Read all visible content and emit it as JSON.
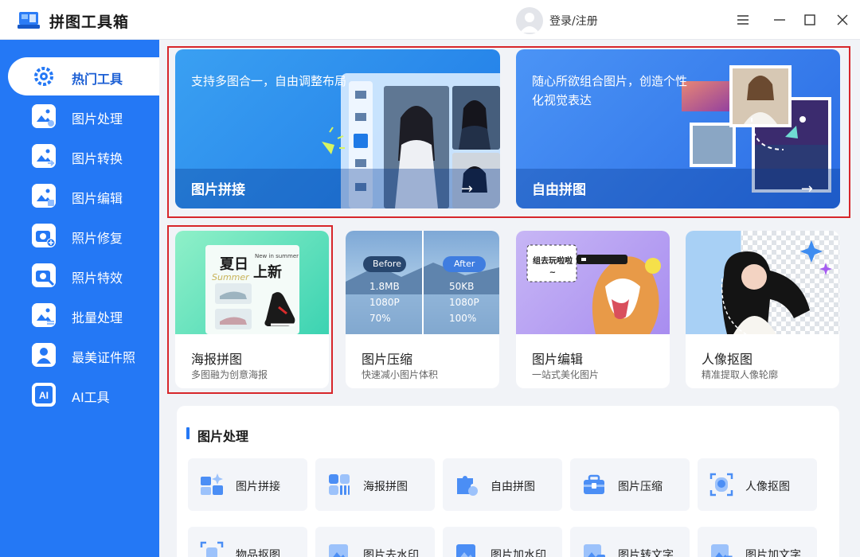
{
  "app": {
    "title": "拼图工具箱",
    "login_text": "登录/注册"
  },
  "colors": {
    "accent": "#2478f5",
    "highlight_border": "#d7262a"
  },
  "sidebar": {
    "items": [
      {
        "label": "热门工具",
        "icon": "gear-icon",
        "active": true
      },
      {
        "label": "图片处理",
        "icon": "image-process-icon"
      },
      {
        "label": "图片转换",
        "icon": "image-convert-icon"
      },
      {
        "label": "图片编辑",
        "icon": "image-edit-icon"
      },
      {
        "label": "照片修复",
        "icon": "camera-plus-icon"
      },
      {
        "label": "照片特效",
        "icon": "camera-effect-icon"
      },
      {
        "label": "批量处理",
        "icon": "batch-icon"
      },
      {
        "label": "最美证件照",
        "icon": "id-photo-icon"
      },
      {
        "label": "AI工具",
        "icon": "ai-icon"
      }
    ]
  },
  "banners": [
    {
      "desc": "支持多图合一，自由调整布局",
      "title": "图片拼接",
      "arrow": "→"
    },
    {
      "desc": "随心所欲组合图片，创造个性化视觉表达",
      "title": "自由拼图",
      "arrow": "→"
    }
  ],
  "cards": [
    {
      "title": "海报拼图",
      "sub": "多图融为创意海报",
      "img_text": {
        "main_a": "夏日",
        "main_b": "上新",
        "small": "New in summer",
        "script": "Summer"
      }
    },
    {
      "title": "图片压缩",
      "sub": "快速减小图片体积",
      "img_text": {
        "before": "Before",
        "after": "After",
        "before_vals": [
          "1.8MB",
          "1080P",
          "70%"
        ],
        "after_vals": [
          "50KB",
          "1080P",
          "100%"
        ]
      }
    },
    {
      "title": "图片编辑",
      "sub": "一站式美化图片",
      "img_text": {
        "bubble": "组去玩啦啦~"
      }
    },
    {
      "title": "人像抠图",
      "sub": "精准提取人像轮廓"
    }
  ],
  "section": {
    "title": "图片处理",
    "row1": [
      {
        "label": "图片拼接",
        "icon": "puzzle-icon"
      },
      {
        "label": "海报拼图",
        "icon": "poster-grid-icon"
      },
      {
        "label": "自由拼图",
        "icon": "jigsaw-icon"
      },
      {
        "label": "图片压缩",
        "icon": "compress-box-icon"
      },
      {
        "label": "人像抠图",
        "icon": "portrait-cutout-icon"
      }
    ],
    "row2": [
      {
        "label": "物品抠图",
        "icon": "object-cutout-icon"
      },
      {
        "label": "图片去水印",
        "icon": "remove-watermark-icon"
      },
      {
        "label": "图片加水印",
        "icon": "add-watermark-icon"
      },
      {
        "label": "图片转文字",
        "icon": "image-to-text-icon"
      },
      {
        "label": "图片加文字",
        "icon": "add-text-icon"
      }
    ]
  }
}
